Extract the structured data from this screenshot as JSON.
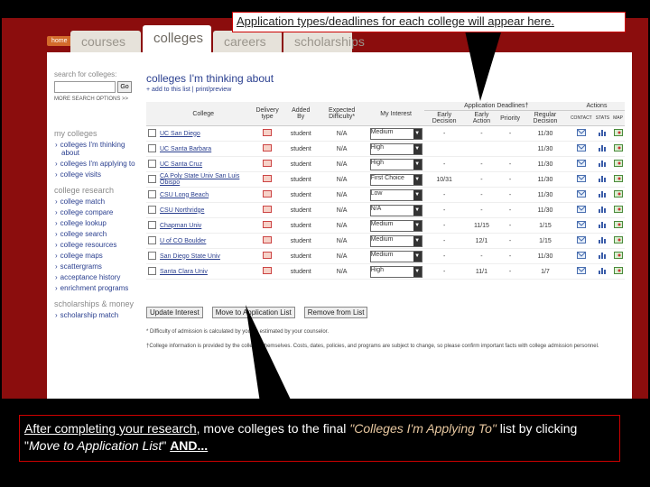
{
  "tabs": {
    "home": "home",
    "courses": "courses",
    "colleges": "colleges",
    "t3": "careers",
    "t4": "scholarships"
  },
  "sidebar": {
    "search_label": "search for colleges:",
    "search_placeholder": "",
    "go": "Go",
    "more_options": "MORE SEARCH OPTIONS >>",
    "my_colleges_header": "my colleges",
    "my_colleges": [
      "colleges I'm thinking about",
      "colleges I'm applying to",
      "college visits"
    ],
    "research_header": "college research",
    "research": [
      "college match",
      "college compare",
      "college lookup",
      "college search",
      "college resources",
      "college maps",
      "scattergrams",
      "acceptance history",
      "enrichment programs"
    ],
    "scholarships_header": "scholarships & money",
    "scholarships": [
      "scholarship match"
    ]
  },
  "main": {
    "title": "colleges I'm thinking about",
    "link_add": "+ add to this list",
    "link_print": "print/preview",
    "headers": {
      "college": "College",
      "delivery": "Delivery type",
      "added_by": "Added By",
      "difficulty": "Expected Difficulty*",
      "interest": "My Interest",
      "deadlines": "Application Deadlines†",
      "early_decision": "Early Decision",
      "early_action": "Early Action",
      "priority": "Priority",
      "regular": "Regular Decision",
      "actions": "Actions",
      "a1": "CONTACT",
      "a2": "STATS",
      "a3": "MAP"
    },
    "rows": [
      {
        "name": "UC San Diego",
        "added": "student",
        "diff": "N/A",
        "interest": "Medium",
        "ed": "-",
        "ea": "-",
        "pr": "-",
        "rd": "11/30"
      },
      {
        "name": "UC Santa Barbara",
        "added": "student",
        "diff": "N/A",
        "interest": "High",
        "ed": "",
        "ea": "",
        "pr": "",
        "rd": "11/30"
      },
      {
        "name": "UC Santa Cruz",
        "added": "student",
        "diff": "N/A",
        "interest": "High",
        "ed": "-",
        "ea": "-",
        "pr": "-",
        "rd": "11/30"
      },
      {
        "name": "CA Poly State Univ San Luis Obispo",
        "added": "student",
        "diff": "N/A",
        "interest": "First Choice",
        "ed": "10/31",
        "ea": "-",
        "pr": "-",
        "rd": "11/30"
      },
      {
        "name": "CSU Long Beach",
        "added": "student",
        "diff": "N/A",
        "interest": "Low",
        "ed": "-",
        "ea": "-",
        "pr": "-",
        "rd": "11/30"
      },
      {
        "name": "CSU Northridge",
        "added": "student",
        "diff": "N/A",
        "interest": "N/A",
        "ed": "-",
        "ea": "-",
        "pr": "-",
        "rd": "11/30"
      },
      {
        "name": "Chapman Univ",
        "added": "student",
        "diff": "N/A",
        "interest": "Medium",
        "ed": "-",
        "ea": "11/15",
        "pr": "-",
        "rd": "1/15"
      },
      {
        "name": "U of CO Boulder",
        "added": "student",
        "diff": "N/A",
        "interest": "Medium",
        "ed": "-",
        "ea": "12/1",
        "pr": "-",
        "rd": "1/15"
      },
      {
        "name": "San Diego State Univ",
        "added": "student",
        "diff": "N/A",
        "interest": "Medium",
        "ed": "-",
        "ea": "-",
        "pr": "-",
        "rd": "11/30"
      },
      {
        "name": "Santa Clara Univ",
        "added": "student",
        "diff": "N/A",
        "interest": "High",
        "ed": "-",
        "ea": "11/1",
        "pr": "-",
        "rd": "1/7"
      }
    ],
    "buttons": {
      "update": "Update Interest",
      "move": "Move to Application List",
      "remove": "Remove from List"
    },
    "foot1": "* Difficulty of admission is calculated by you as estimated by your counselor.",
    "foot2": "†College information is provided by the colleges themselves. Costs, dates, policies, and programs are subject to change, so please confirm important facts with college admission personnel."
  },
  "callouts": {
    "top": "Application types/deadlines for each college will appear here.",
    "bottom_1": "After completing your research",
    "bottom_2": ", move colleges to the final ",
    "bottom_3": "\"Colleges I'm Applying To\"",
    "bottom_4": " list by clicking \"",
    "bottom_5": "Move to Application List",
    "bottom_6": "\" ",
    "bottom_7": "AND..."
  }
}
